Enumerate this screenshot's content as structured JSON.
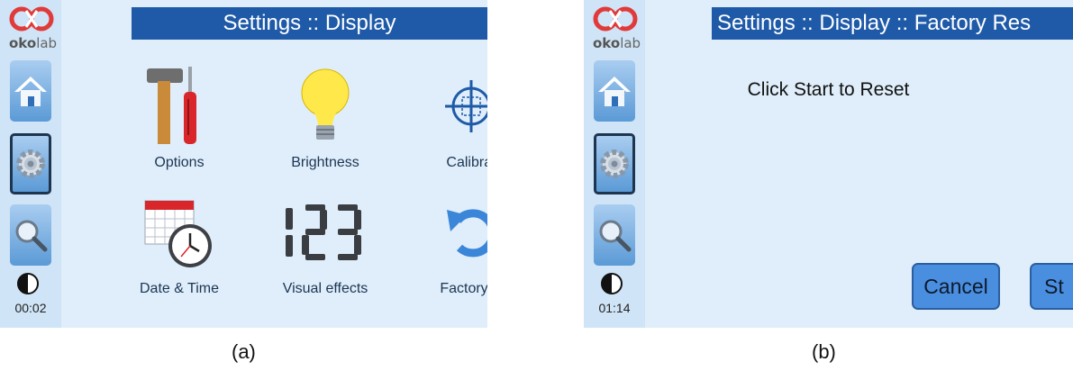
{
  "panel_a": {
    "logo_text": "okolab",
    "title": "Settings :: Display",
    "clock": "00:02",
    "items": [
      {
        "label": "Options",
        "icon": "tools-icon"
      },
      {
        "label": "Brightness",
        "icon": "lightbulb-icon"
      },
      {
        "label": "Calibrat",
        "icon": "crosshair-icon"
      },
      {
        "label": "Date & Time",
        "icon": "calendar-clock-icon"
      },
      {
        "label": "Visual effects",
        "icon": "digits-icon"
      },
      {
        "label": "Factory R",
        "icon": "undo-icon"
      }
    ],
    "caption": "(a)"
  },
  "panel_b": {
    "logo_text": "okolab",
    "title": "Settings :: Display :: Factory Res",
    "clock": "01:14",
    "message": "Click Start to Reset",
    "cancel_label": "Cancel",
    "start_label": "St",
    "caption": "(b)"
  },
  "colors": {
    "title_bar": "#1f5aa8",
    "panel_bg": "#dfeefa",
    "button": "#4a8ee0",
    "logo_red": "#e03a3a"
  }
}
